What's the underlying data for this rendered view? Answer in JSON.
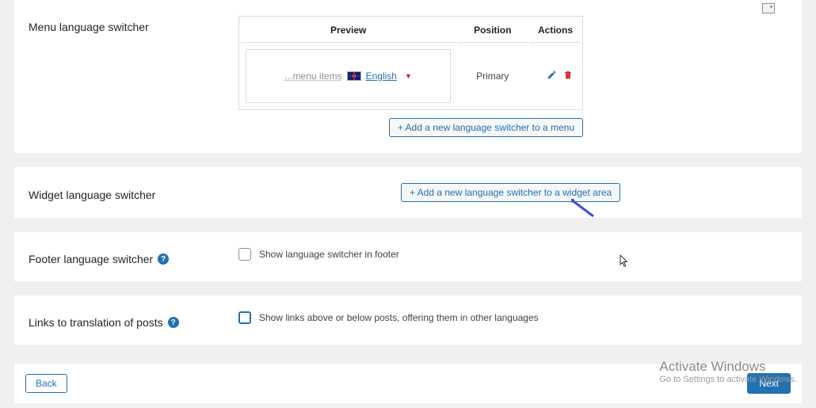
{
  "sections": {
    "menuSwitcher": {
      "title": "Menu language switcher",
      "table": {
        "headers": {
          "preview": "Preview",
          "position": "Position",
          "actions": "Actions"
        },
        "row": {
          "menuItemsText": "...menu items",
          "language": "English",
          "position": "Primary",
          "editIcon": "edit",
          "deleteIcon": "delete"
        }
      },
      "addButton": "+ Add a new language switcher to a menu"
    },
    "widgetSwitcher": {
      "title": "Widget language switcher",
      "addButton": "+ Add a new language switcher to a widget area"
    },
    "footerSwitcher": {
      "title": "Footer language switcher",
      "checkboxLabel": "Show language switcher in footer"
    },
    "translationLinks": {
      "title": "Links to translation of posts",
      "checkboxLabel": "Show links above or below posts, offering them in other languages"
    }
  },
  "nav": {
    "back": "Back",
    "next": "Next"
  },
  "watermark": {
    "line1": "Activate Windows",
    "line2": "Go to Settings to activate Windows."
  },
  "colors": {
    "accent": "#2271b1",
    "danger": "#d63638"
  },
  "helpGlyph": "?"
}
